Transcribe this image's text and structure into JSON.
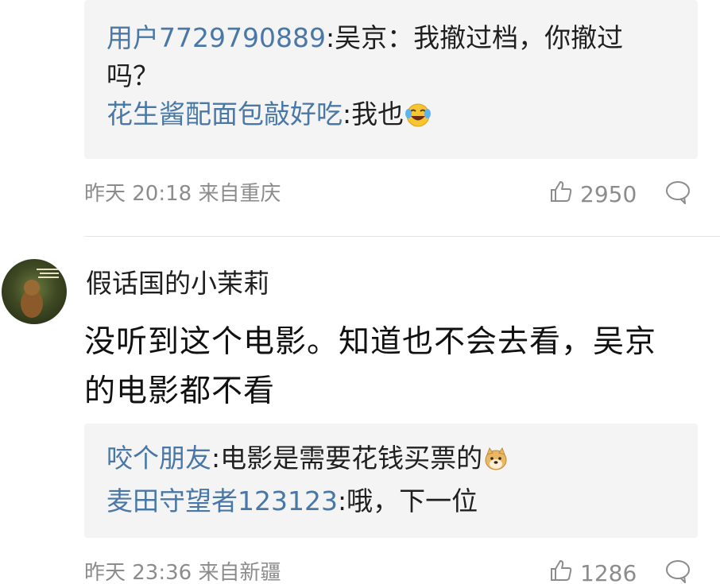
{
  "thread1": {
    "replies": [
      {
        "user": "用户7729790889",
        "sep": ":",
        "text_line1": "吴京：我撤过档，你撤过",
        "text_line2": "吗？"
      },
      {
        "user": "花生酱配面包敲好吃",
        "sep": ":",
        "text": "我也",
        "emoji": "laugh-cry-icon"
      }
    ],
    "meta": {
      "time": "昨天 20:18",
      "location": "来自重庆",
      "likes": "2950"
    }
  },
  "comment2": {
    "author": "假话国的小茉莉",
    "text_line1": "没听到这个电影。知道也不会去看，吴京",
    "text_line2": "的电影都不看",
    "replies": [
      {
        "user": "咬个朋友",
        "sep": ":",
        "text": "电影是需要花钱买票的",
        "emoji": "doge-icon"
      },
      {
        "user": "麦田守望者123123",
        "sep": ":",
        "text": "哦，下一位"
      }
    ],
    "meta": {
      "time": "昨天 23:36",
      "location": "来自新疆",
      "likes": "1286"
    }
  },
  "colors": {
    "username_blue": "#4a78a6",
    "meta_gray": "#8c8c8c",
    "reply_bg": "#f4f4f4"
  }
}
